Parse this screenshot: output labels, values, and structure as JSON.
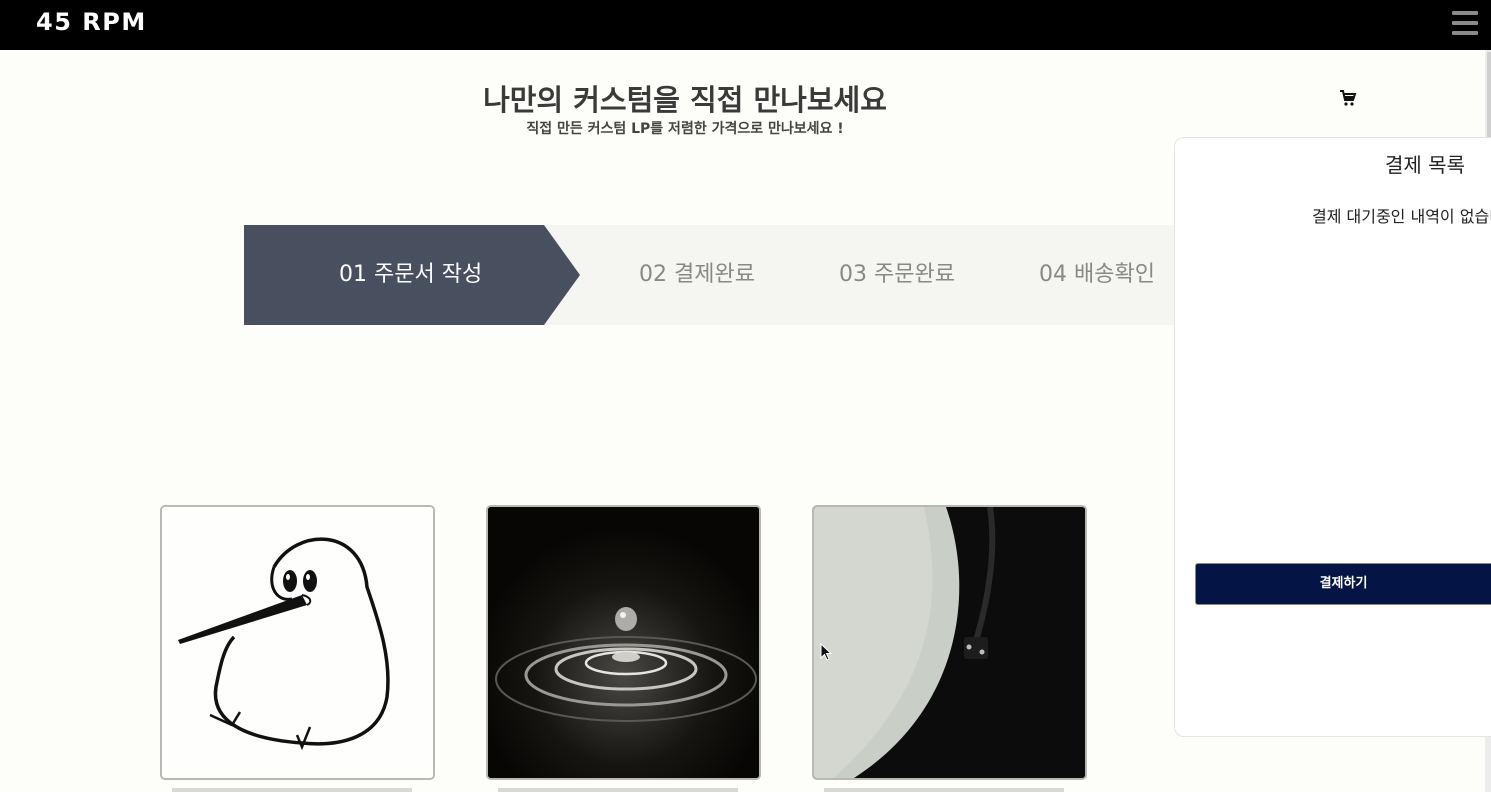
{
  "header": {
    "brand": "45 RPM",
    "menu_icon": "hamburger-menu-icon",
    "background": "#000000"
  },
  "hero": {
    "title": "나만의 커스텀을 직접 만나보세요",
    "subtitle": "직접 만든 커스텀 LP를 저렴한 가격으로 만나보세요 !"
  },
  "cart_icon": "shopping-cart-icon",
  "steps": [
    {
      "label": "01 주문서 작성",
      "active": true
    },
    {
      "label": "02 결제완료",
      "active": false
    },
    {
      "label": "03 주문완료",
      "active": false
    },
    {
      "label": "04 배송확인",
      "active": false
    }
  ],
  "payment_panel": {
    "title": "결제 목록",
    "empty_message": "결제 대기중인 내역이 없습니다",
    "pay_button": "결제하기",
    "pay_button_color": "#041545"
  },
  "products": [
    {
      "image": "kiwi-bird-line-drawing"
    },
    {
      "image": "water-droplet-ripple"
    },
    {
      "image": "vinyl-record-turntable"
    }
  ],
  "colors": {
    "step_active": "#484f5f",
    "step_track": "#f5f5f2",
    "page_background": "#fdfdfa"
  }
}
